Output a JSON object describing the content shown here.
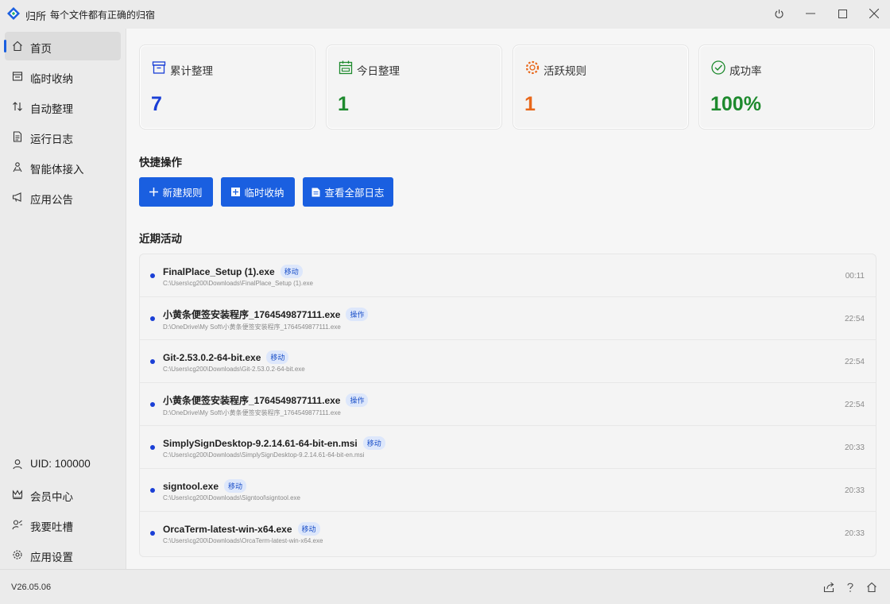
{
  "app": {
    "name": "归所",
    "slogan": "每个文件都有正确的归宿"
  },
  "colors": {
    "accent": "#1a5fe0",
    "stat_blue": "#1a3fd6",
    "stat_green": "#1e8a2e",
    "stat_orange": "#e8671a"
  },
  "sidebar": {
    "items": [
      {
        "label": "首页",
        "icon": "home-icon",
        "active": true
      },
      {
        "label": "临时收纳",
        "icon": "inbox-icon"
      },
      {
        "label": "自动整理",
        "icon": "sort-arrows-icon"
      },
      {
        "label": "运行日志",
        "icon": "log-icon"
      },
      {
        "label": "智能体接入",
        "icon": "agent-icon"
      },
      {
        "label": "应用公告",
        "icon": "megaphone-icon"
      }
    ],
    "bottom_items": [
      {
        "label": "UID: 100000",
        "icon": "user-icon"
      },
      {
        "label": "会员中心",
        "icon": "crown-icon"
      },
      {
        "label": "我要吐槽",
        "icon": "feedback-icon"
      },
      {
        "label": "应用设置",
        "icon": "gear-icon"
      }
    ]
  },
  "stats": [
    {
      "label": "累计整理",
      "value": "7",
      "icon": "archive-icon"
    },
    {
      "label": "今日整理",
      "value": "1",
      "icon": "calendar-icon"
    },
    {
      "label": "活跃规则",
      "value": "1",
      "icon": "gear-rule-icon"
    },
    {
      "label": "成功率",
      "value": "100%",
      "icon": "check-circle-icon"
    }
  ],
  "quick_actions": {
    "title": "快捷操作",
    "buttons": [
      {
        "label": "新建规则",
        "icon": "plus-icon"
      },
      {
        "label": "临时收纳",
        "icon": "square-plus-icon"
      },
      {
        "label": "查看全部日志",
        "icon": "document-icon"
      }
    ]
  },
  "recent": {
    "title": "近期活动",
    "items": [
      {
        "name": "FinalPlace_Setup (1).exe",
        "tag": "移动",
        "path": "C:\\Users\\cg200\\Downloads\\FinalPlace_Setup (1).exe",
        "time": "00:11"
      },
      {
        "name": "小黄条便签安装程序_1764549877111.exe",
        "tag": "操作",
        "path": "D:\\OneDrive\\My Soft\\小黄条便签安装程序_1764549877111.exe",
        "time": "22:54"
      },
      {
        "name": "Git-2.53.0.2-64-bit.exe",
        "tag": "移动",
        "path": "C:\\Users\\cg200\\Downloads\\Git-2.53.0.2-64-bit.exe",
        "time": "22:54"
      },
      {
        "name": "小黄条便签安装程序_1764549877111.exe",
        "tag": "操作",
        "path": "D:\\OneDrive\\My Soft\\小黄条便签安装程序_1764549877111.exe",
        "time": "22:54"
      },
      {
        "name": "SimplySignDesktop-9.2.14.61-64-bit-en.msi",
        "tag": "移动",
        "path": "C:\\Users\\cg200\\Downloads\\SimplySignDesktop-9.2.14.61-64-bit-en.msi",
        "time": "20:33"
      },
      {
        "name": "signtool.exe",
        "tag": "移动",
        "path": "C:\\Users\\cg200\\Downloads\\Signtool\\signtool.exe",
        "time": "20:33"
      },
      {
        "name": "OrcaTerm-latest-win-x64.exe",
        "tag": "移动",
        "path": "C:\\Users\\cg200\\Downloads\\OrcaTerm-latest-win-x64.exe",
        "time": "20:33"
      }
    ]
  },
  "footer": {
    "version": "V26.05.06"
  }
}
